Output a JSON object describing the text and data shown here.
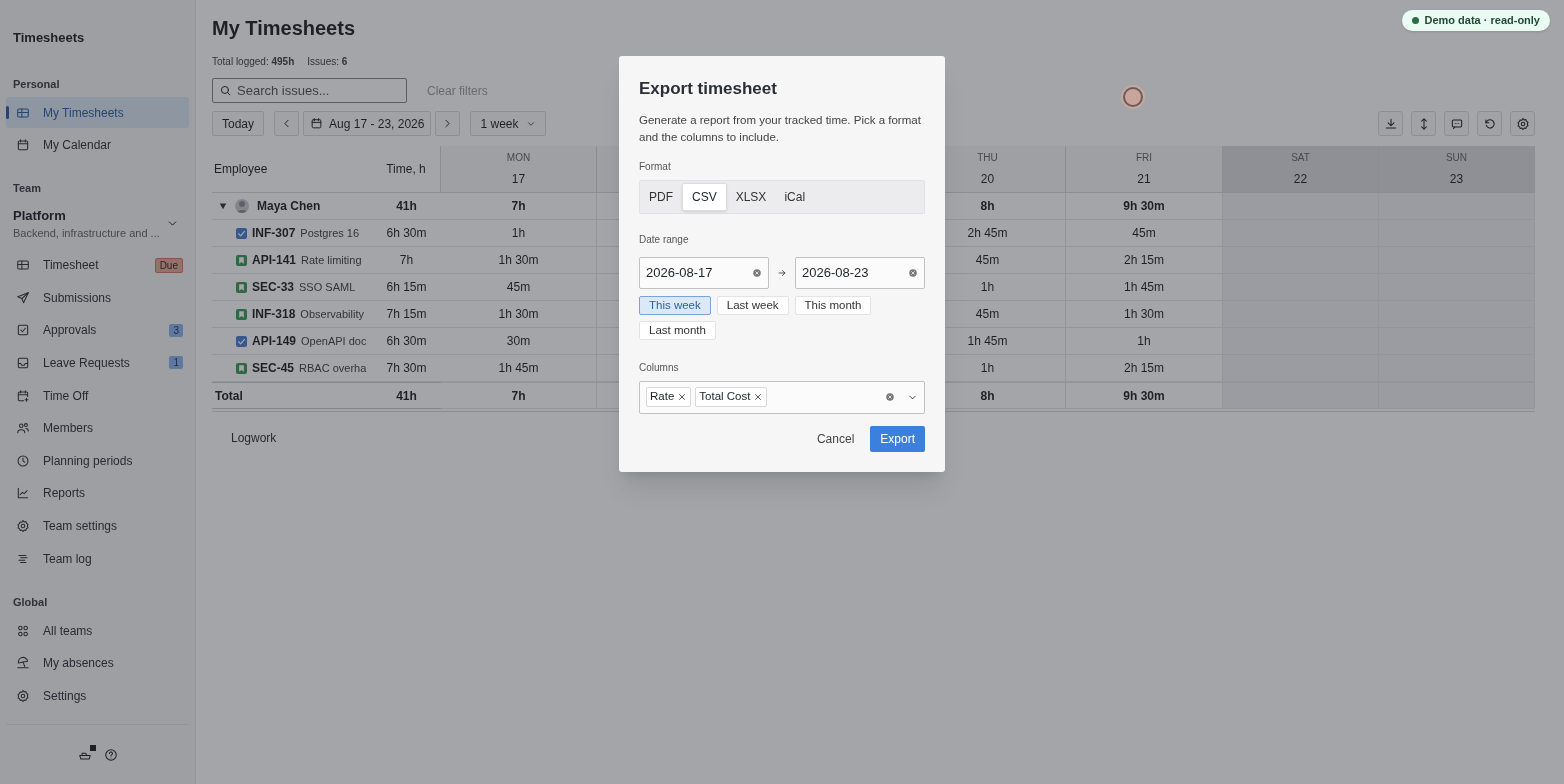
{
  "app_title": "Timesheets",
  "sidebar": {
    "sections": [
      {
        "title": "Personal",
        "items": [
          {
            "label": "My Timesheets",
            "selected": true
          },
          {
            "label": "My Calendar",
            "selected": false
          }
        ]
      },
      {
        "title": "Team",
        "team": {
          "name": "Platform",
          "description": "Backend, infrastructure and ..."
        },
        "items": [
          {
            "label": "Timesheet",
            "selected": false,
            "badge": {
              "text": "Due",
              "kind": "status"
            }
          },
          {
            "label": "Submissions",
            "selected": false
          },
          {
            "label": "Approvals",
            "selected": false,
            "badge": {
              "text": "3",
              "kind": "count"
            }
          },
          {
            "label": "Leave Requests",
            "selected": false,
            "badge": {
              "text": "1",
              "kind": "count"
            }
          },
          {
            "label": "Time Off",
            "selected": false
          },
          {
            "label": "Members",
            "selected": false
          },
          {
            "label": "Planning periods",
            "selected": false
          },
          {
            "label": "Reports",
            "selected": false
          },
          {
            "label": "Team settings",
            "selected": false
          },
          {
            "label": "Team log",
            "selected": false
          }
        ]
      },
      {
        "title": "Global",
        "items": [
          {
            "label": "All teams",
            "selected": false
          },
          {
            "label": "My absences",
            "selected": false
          },
          {
            "label": "Settings",
            "selected": false
          }
        ]
      }
    ]
  },
  "page": {
    "title": "My Timesheets",
    "stats": [
      {
        "label": "Total logged:",
        "value": "495h"
      },
      {
        "label": "Issues:",
        "value": "6"
      }
    ],
    "search": {
      "placeholder": "Search issues..."
    },
    "clear_filters": "Clear filters",
    "today": "Today",
    "date_range": "Aug 17 - 23, 2026",
    "period": "1 week",
    "badge": "Demo data · read-only"
  },
  "table": {
    "columns": {
      "employee": "Employee",
      "time": "Time, h"
    },
    "days": [
      {
        "day": "MON",
        "date": "17",
        "weekend": false
      },
      {
        "day": "THU",
        "date": "20",
        "weekend": false
      },
      {
        "day": "FRI",
        "date": "21",
        "weekend": false
      },
      {
        "day": "SAT",
        "date": "22",
        "weekend": true
      },
      {
        "day": "SUN",
        "date": "23",
        "weekend": true
      }
    ],
    "employee": {
      "name": "Maya Chen",
      "expanded": true,
      "total": "41h",
      "days": [
        "7h",
        "8h",
        "9h 30m"
      ]
    },
    "rows": [
      {
        "kind": "task",
        "key": "INF-307",
        "summary": "Postgres 16",
        "total": "6h 30m",
        "days": [
          "1h",
          "2h 45m",
          "45m"
        ]
      },
      {
        "kind": "story",
        "key": "API-141",
        "summary": "Rate limiting",
        "total": "7h",
        "days": [
          "1h 30m",
          "45m",
          "2h 15m"
        ]
      },
      {
        "kind": "story",
        "key": "SEC-33",
        "summary": "SSO SAML",
        "total": "6h 15m",
        "days": [
          "45m",
          "1h",
          "1h 45m"
        ]
      },
      {
        "kind": "story",
        "key": "INF-318",
        "summary": "Observability",
        "total": "7h 15m",
        "days": [
          "1h 30m",
          "45m",
          "1h 30m"
        ]
      },
      {
        "kind": "task",
        "key": "API-149",
        "summary": "OpenAPI doc",
        "total": "6h 30m",
        "days": [
          "30m",
          "1h 45m",
          "1h"
        ]
      },
      {
        "kind": "story",
        "key": "SEC-45",
        "summary": "RBAC overha",
        "total": "7h 30m",
        "days": [
          "1h 45m",
          "1h",
          "2h 15m"
        ]
      }
    ],
    "total_row": {
      "label": "Total",
      "total": "41h",
      "days": [
        "7h",
        "8h",
        "9h 30m"
      ]
    },
    "logwork": "Logwork"
  },
  "dialog": {
    "title": "Export timesheet",
    "description": "Generate a report from your tracked time. Pick a format and the columns to include.",
    "format_label": "Format",
    "formats": [
      {
        "label": "PDF",
        "selected": false
      },
      {
        "label": "CSV",
        "selected": true
      },
      {
        "label": "XLSX",
        "selected": false
      },
      {
        "label": "iCal",
        "selected": false
      }
    ],
    "date_label": "Date range",
    "date_from": "2026-08-17",
    "date_to": "2026-08-23",
    "presets": [
      {
        "label": "This week",
        "selected": true
      },
      {
        "label": "Last week",
        "selected": false
      },
      {
        "label": "This month",
        "selected": false
      },
      {
        "label": "Last month",
        "selected": false
      }
    ],
    "columns_label": "Columns",
    "columns": [
      "Rate",
      "Total Cost"
    ],
    "cancel": "Cancel",
    "export": "Export"
  }
}
